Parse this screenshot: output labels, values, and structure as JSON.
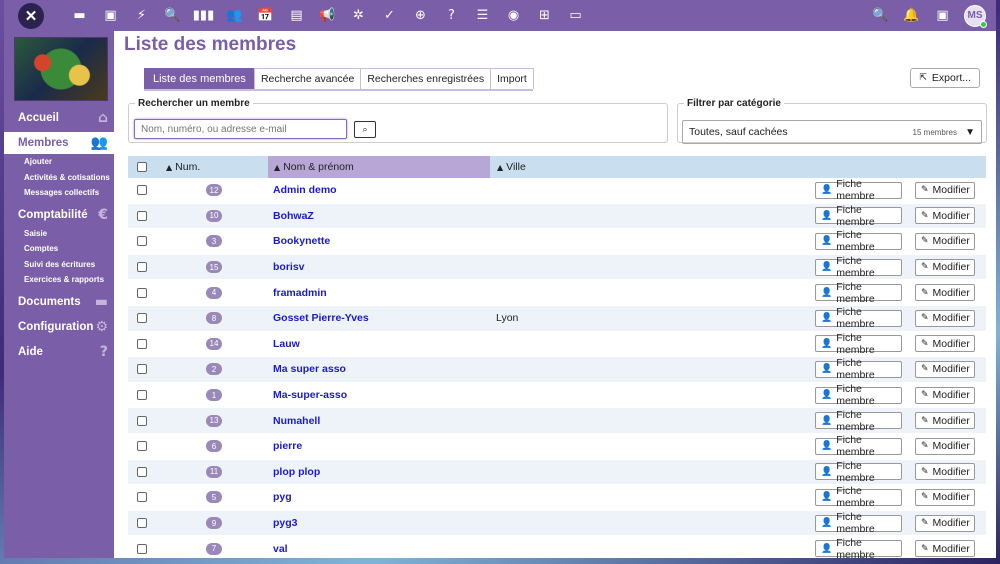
{
  "topbar": {
    "logo": "✕",
    "icons": [
      "folder-icon",
      "image-icon",
      "bolt-icon",
      "search-chat-icon",
      "columns-icon",
      "users-icon",
      "calendar-icon",
      "inbox-icon",
      "megaphone-icon",
      "star-person-icon",
      "check-icon",
      "globe-icon",
      "help-icon",
      "list-icon",
      "eye-icon",
      "grid-icon",
      "laptop-icon"
    ],
    "glyphs": [
      "▬",
      "▣",
      "⚡",
      "🔍",
      "▮▮▮",
      "👥",
      "📅",
      "▤",
      "📢",
      "✲",
      "✓",
      "⊕",
      "?",
      "☰",
      "◉",
      "⊞",
      "▭"
    ],
    "right_icons": [
      "search-icon",
      "bell-icon",
      "contact-card-icon"
    ],
    "right_glyphs": [
      "🔍",
      "🔔",
      "▣"
    ],
    "avatar": "MS"
  },
  "sidebar": {
    "sections": [
      {
        "label": "Accueil",
        "icon": "home-icon",
        "glyph": "⌂",
        "subs": []
      },
      {
        "label": "Membres",
        "icon": "users-icon",
        "glyph": "👥",
        "active": true,
        "subs": [
          "Ajouter",
          "Activités & cotisations",
          "Messages collectifs"
        ]
      },
      {
        "label": "Comptabilité",
        "icon": "euro-icon",
        "glyph": "€",
        "subs": [
          "Saisie",
          "Comptes",
          "Suivi des écritures",
          "Exercices & rapports"
        ]
      },
      {
        "label": "Documents",
        "icon": "folder-icon",
        "glyph": "▬",
        "subs": []
      },
      {
        "label": "Configuration",
        "icon": "gear-icon",
        "glyph": "⚙",
        "subs": []
      },
      {
        "label": "Aide",
        "icon": "help-icon",
        "glyph": "?",
        "subs": []
      }
    ]
  },
  "main": {
    "title": "Liste des membres",
    "tabs": [
      "Liste des membres",
      "Recherche avancée",
      "Recherches enregistrées",
      "Import"
    ],
    "export_label": "Export...",
    "search": {
      "legend": "Rechercher un membre",
      "placeholder": "Nom, numéro, ou adresse e-mail"
    },
    "filter": {
      "legend": "Filtrer par catégorie",
      "selected": "Toutes, sauf cachées",
      "count": "15 membres"
    }
  },
  "table": {
    "columns": {
      "num": "Num.",
      "name": "Nom & prénom",
      "city": "Ville"
    },
    "fiche_label": "Fiche membre",
    "modify_label": "Modifier",
    "rows": [
      {
        "num": "12",
        "name": "Admin demo",
        "city": ""
      },
      {
        "num": "10",
        "name": "BohwaZ",
        "city": ""
      },
      {
        "num": "3",
        "name": "Bookynette",
        "city": ""
      },
      {
        "num": "15",
        "name": "borisv",
        "city": ""
      },
      {
        "num": "4",
        "name": "framadmin",
        "city": ""
      },
      {
        "num": "8",
        "name": "Gosset Pierre-Yves",
        "city": "Lyon"
      },
      {
        "num": "14",
        "name": "Lauw",
        "city": ""
      },
      {
        "num": "2",
        "name": "Ma super asso",
        "city": ""
      },
      {
        "num": "1",
        "name": "Ma-super-asso",
        "city": ""
      },
      {
        "num": "13",
        "name": "Numahell",
        "city": ""
      },
      {
        "num": "6",
        "name": "pierre",
        "city": ""
      },
      {
        "num": "11",
        "name": "plop plop",
        "city": ""
      },
      {
        "num": "5",
        "name": "pyg",
        "city": ""
      },
      {
        "num": "9",
        "name": "pyg3",
        "city": ""
      },
      {
        "num": "7",
        "name": "val",
        "city": ""
      }
    ]
  }
}
